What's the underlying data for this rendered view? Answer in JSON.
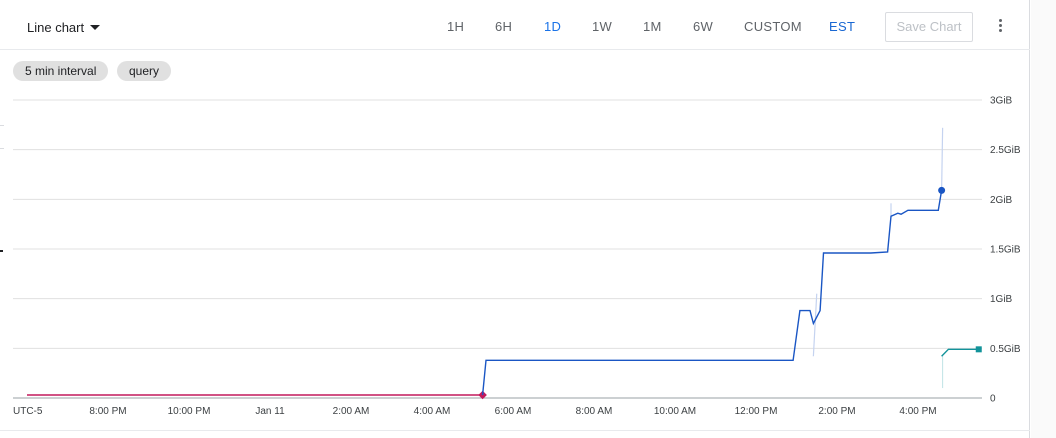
{
  "toolbar": {
    "chart_type": "Line chart",
    "ranges": [
      "1H",
      "6H",
      "1D",
      "1W",
      "1M",
      "6W",
      "CUSTOM"
    ],
    "active_range": "1D",
    "timezone": "EST",
    "save_label": "Save Chart"
  },
  "chips": [
    "5 min interval",
    "query"
  ],
  "colors": {
    "accent": "#1a73e8",
    "primary_series": "#1a56c4",
    "secondary_series": "#12939a",
    "baseline_series": "#c2185b"
  },
  "chart_data": {
    "type": "line",
    "x_unit": "hours (EST, Jan 10 6:00 PM – Jan 11 5:30 PM)",
    "x_ticks": [
      "UTC-5",
      "8:00 PM",
      "10:00 PM",
      "Jan 11",
      "2:00 AM",
      "4:00 AM",
      "6:00 AM",
      "8:00 AM",
      "10:00 AM",
      "12:00 PM",
      "2:00 PM",
      "4:00 PM"
    ],
    "y_ticks": [
      "0",
      "0.5GiB",
      "1GiB",
      "1.5GiB",
      "2GiB",
      "2.5GiB",
      "3GiB"
    ],
    "ylim": [
      0,
      3
    ],
    "y_unit": "GiB",
    "series": [
      {
        "color": "#c2185b",
        "marker": "diamond",
        "points": [
          [
            "Jan 10 6:00 PM",
            0.03
          ],
          [
            "Jan 11 5:15 AM",
            0.03
          ]
        ]
      },
      {
        "color": "#1a56c4",
        "marker": "circle",
        "points": [
          [
            "Jan 11 5:15 AM",
            0.03
          ],
          [
            "Jan 11 5:20 AM",
            0.38
          ],
          [
            "Jan 11 12:55 PM",
            0.38
          ],
          [
            "Jan 11 1:05 PM",
            0.88
          ],
          [
            "Jan 11 1:20 PM",
            0.88
          ],
          [
            "Jan 11 1:25 PM",
            0.75
          ],
          [
            "Jan 11 1:35 PM",
            0.88
          ],
          [
            "Jan 11 1:40 PM",
            1.46
          ],
          [
            "Jan 11 2:50 PM",
            1.46
          ],
          [
            "Jan 11 3:15 PM",
            1.47
          ],
          [
            "Jan 11 3:20 PM",
            1.83
          ],
          [
            "Jan 11 3:30 PM",
            1.86
          ],
          [
            "Jan 11 3:35 PM",
            1.85
          ],
          [
            "Jan 11 3:45 PM",
            1.89
          ],
          [
            "Jan 11 4:30 PM",
            1.89
          ],
          [
            "Jan 11 4:35 PM",
            2.09
          ]
        ]
      },
      {
        "color": "#12939a",
        "marker": "square",
        "points": [
          [
            "Jan 11 4:35 PM",
            0.42
          ],
          [
            "Jan 11 4:45 PM",
            0.49
          ],
          [
            "Jan 11 5:30 PM",
            0.49
          ]
        ]
      }
    ]
  }
}
